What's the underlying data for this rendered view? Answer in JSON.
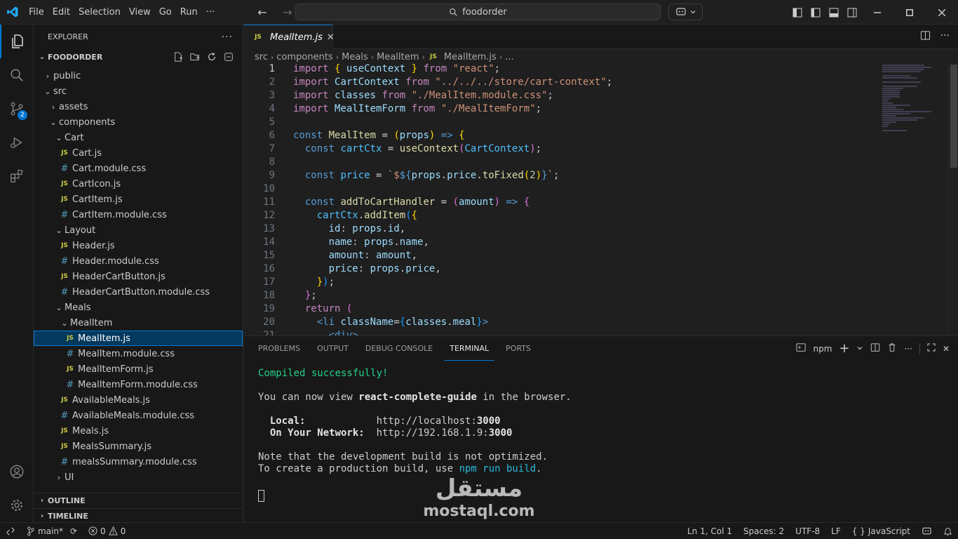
{
  "titlebar": {
    "menu": [
      "File",
      "Edit",
      "Selection",
      "View",
      "Go",
      "Run",
      "···"
    ],
    "search_text": "foodorder"
  },
  "activity": {
    "source_control_badge": "2"
  },
  "explorer": {
    "title": "EXPLORER",
    "more": "···",
    "folder": "FOODORDER",
    "tree": [
      {
        "label": "public",
        "type": "folder",
        "open": false,
        "depth": 0
      },
      {
        "label": "src",
        "type": "folder",
        "open": true,
        "depth": 0
      },
      {
        "label": "assets",
        "type": "folder",
        "open": false,
        "depth": 1
      },
      {
        "label": "components",
        "type": "folder",
        "open": true,
        "depth": 1
      },
      {
        "label": "Cart",
        "type": "folder",
        "open": true,
        "depth": 2
      },
      {
        "label": "Cart.js",
        "type": "js",
        "depth": 3
      },
      {
        "label": "Cart.module.css",
        "type": "css",
        "depth": 3
      },
      {
        "label": "CartIcon.js",
        "type": "js",
        "depth": 3
      },
      {
        "label": "CartItem.js",
        "type": "js",
        "depth": 3
      },
      {
        "label": "CartItem.module.css",
        "type": "css",
        "depth": 3
      },
      {
        "label": "Layout",
        "type": "folder",
        "open": true,
        "depth": 2
      },
      {
        "label": "Header.js",
        "type": "js",
        "depth": 3
      },
      {
        "label": "Header.module.css",
        "type": "css",
        "depth": 3
      },
      {
        "label": "HeaderCartButton.js",
        "type": "js",
        "depth": 3
      },
      {
        "label": "HeaderCartButton.module.css",
        "type": "css",
        "depth": 3
      },
      {
        "label": "Meals",
        "type": "folder",
        "open": true,
        "depth": 2
      },
      {
        "label": "MealItem",
        "type": "folder",
        "open": true,
        "depth": 3
      },
      {
        "label": "MealItem.js",
        "type": "js",
        "depth": 4,
        "selected": true
      },
      {
        "label": "MealItem.module.css",
        "type": "css",
        "depth": 4
      },
      {
        "label": "MealItemForm.js",
        "type": "js",
        "depth": 4
      },
      {
        "label": "MealItemForm.module.css",
        "type": "css",
        "depth": 4
      },
      {
        "label": "AvailableMeals.js",
        "type": "js",
        "depth": 3
      },
      {
        "label": "AvailableMeals.module.css",
        "type": "css",
        "depth": 3
      },
      {
        "label": "Meals.js",
        "type": "js",
        "depth": 3
      },
      {
        "label": "MealsSummary.js",
        "type": "js",
        "depth": 3
      },
      {
        "label": "mealsSummary.module.css",
        "type": "css",
        "depth": 3
      },
      {
        "label": "UI",
        "type": "folder",
        "open": false,
        "depth": 2
      }
    ],
    "outline": "OUTLINE",
    "timeline": "TIMELINE"
  },
  "editor": {
    "tab": "MealItem.js",
    "file_icon": "JS",
    "breadcrumb": [
      "src",
      "components",
      "Meals",
      "MealItem",
      "MealItem.js",
      "..."
    ],
    "current_line": 1
  },
  "panel": {
    "tabs": [
      "PROBLEMS",
      "OUTPUT",
      "DEBUG CONSOLE",
      "TERMINAL",
      "PORTS"
    ],
    "active_tab": "TERMINAL",
    "terminal_name": "npm",
    "terminal": {
      "compiled": "Compiled successfully!",
      "view_prefix": "You can now view ",
      "app_name": "react-complete-guide",
      "view_suffix": " in the browser.",
      "local_label": "  Local:            ",
      "local_url": "http://localhost:",
      "local_port": "3000",
      "network_label": "  On Your Network:  ",
      "network_url": "http://192.168.1.9:",
      "network_port": "3000",
      "note": "Note that the development build is not optimized.",
      "build_prefix": "To create a production build, use ",
      "build_cmd": "npm run build",
      "build_suffix": "."
    }
  },
  "watermark": {
    "arabic": "مستقل",
    "latin": "mostaql.com"
  },
  "statusbar": {
    "branch": "main*",
    "errors": "0",
    "warnings": "0",
    "position": "Ln 1, Col 1",
    "spaces": "Spaces: 2",
    "encoding": "UTF-8",
    "eol": "LF",
    "braces": "{ }",
    "language": "JavaScript"
  },
  "colors": {
    "accent": "#0078d4",
    "selected_bg": "#04395e",
    "terminal_green": "#23d18b"
  }
}
